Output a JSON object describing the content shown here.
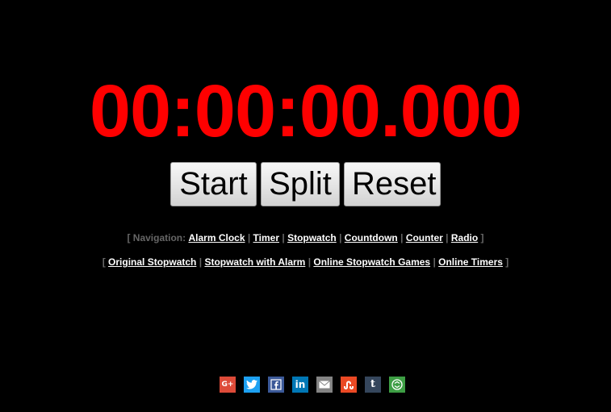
{
  "display": {
    "time": "00:00:00.000",
    "color": "#ff0000"
  },
  "buttons": {
    "start": "Start",
    "split": "Split",
    "reset": "Reset"
  },
  "navigation": {
    "label": "Navigation:",
    "open_bracket": "[",
    "close_bracket": "]",
    "separator": "|",
    "links": [
      "Alarm Clock",
      "Timer",
      "Stopwatch",
      "Countdown",
      "Counter",
      "Radio"
    ]
  },
  "secondary_links": [
    "Original Stopwatch",
    "Stopwatch with Alarm",
    "Online Stopwatch Games",
    "Online Timers"
  ],
  "social": [
    {
      "name": "google-plus-icon",
      "glyph": "G+",
      "color": "#dd4b39"
    },
    {
      "name": "twitter-icon",
      "glyph": "",
      "color": "#1da1f2"
    },
    {
      "name": "facebook-icon",
      "glyph": "f",
      "color": "#3b5998"
    },
    {
      "name": "linkedin-icon",
      "glyph": "in",
      "color": "#0077b5"
    },
    {
      "name": "email-icon",
      "glyph": "",
      "color": "#848484"
    },
    {
      "name": "stumbleupon-icon",
      "glyph": "",
      "color": "#eb4924"
    },
    {
      "name": "tumblr-icon",
      "glyph": "t",
      "color": "#35465c"
    },
    {
      "name": "share-more-icon",
      "glyph": "",
      "color": "#3d9e44"
    }
  ]
}
